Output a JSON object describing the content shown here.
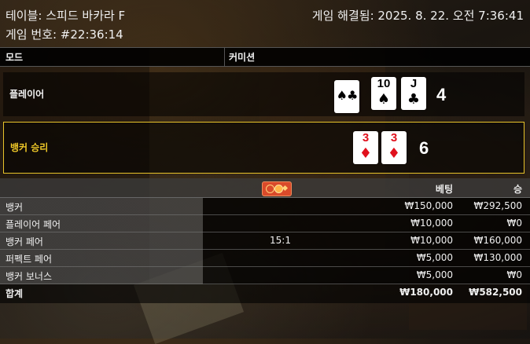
{
  "header": {
    "table": "테이블: 스피드 바카라 F",
    "game_no": "게임 번호: #22:36:14",
    "resolved": "게임 해결됨: 2025. 8. 22. 오전 7:36:41"
  },
  "mode_bar": {
    "mode_label": "모드",
    "mode_value": "커미션"
  },
  "player": {
    "label": "플레이어",
    "score": "4",
    "cards": [
      {
        "rank": "",
        "suit": "♠♣",
        "color": "black",
        "face_down": true
      },
      {
        "rank": "10",
        "suit": "♠",
        "color": "black"
      },
      {
        "rank": "J",
        "suit": "♣",
        "color": "black"
      }
    ]
  },
  "banker": {
    "label": "뱅커 승리",
    "score": "6",
    "highlight_color": "#e8c32a",
    "cards": [
      {
        "rank": "3",
        "suit": "♦",
        "color": "red"
      },
      {
        "rank": "3",
        "suit": "♦",
        "color": "red"
      }
    ]
  },
  "bets_table": {
    "headers": {
      "bet": "베팅",
      "win": "승"
    },
    "chip_icon": "chip-icon",
    "rows": [
      {
        "name": "뱅커",
        "odds": "",
        "bet": "₩150,000",
        "win": "₩292,500"
      },
      {
        "name": "플레이어 페어",
        "odds": "",
        "bet": "₩10,000",
        "win": "₩0"
      },
      {
        "name": "뱅커 페어",
        "odds": "15:1",
        "bet": "₩10,000",
        "win": "₩160,000"
      },
      {
        "name": "퍼펙트 페어",
        "odds": "",
        "bet": "₩5,000",
        "win": "₩130,000"
      },
      {
        "name": "뱅커 보너스",
        "odds": "",
        "bet": "₩5,000",
        "win": "₩0"
      }
    ],
    "total": {
      "name": "합계",
      "bet": "₩180,000",
      "win": "₩582,500"
    }
  }
}
